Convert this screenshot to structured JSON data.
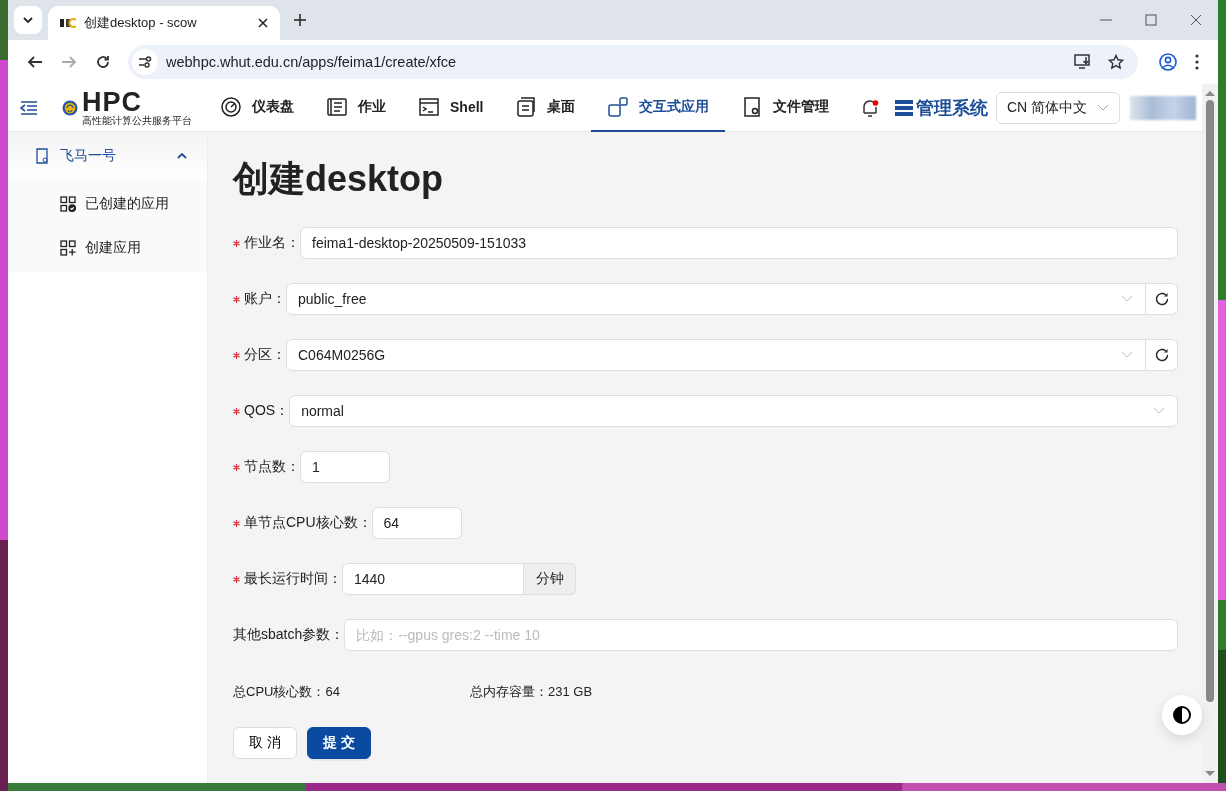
{
  "browser": {
    "tab_title": "创建desktop - scow",
    "url": "webhpc.whut.edu.cn/apps/feima1/create/xfce"
  },
  "header": {
    "logo_text": "HPC",
    "logo_subtitle": "高性能计算公共服务平台",
    "nav": [
      {
        "label": "仪表盘",
        "selected": false
      },
      {
        "label": "作业",
        "selected": false
      },
      {
        "label": "Shell",
        "selected": false
      },
      {
        "label": "桌面",
        "selected": false
      },
      {
        "label": "交互式应用",
        "selected": true
      },
      {
        "label": "文件管理",
        "selected": false
      }
    ],
    "admin_link": "管理系统",
    "language": "CN 简体中文"
  },
  "sidebar": {
    "group": "飞马一号",
    "expanded": true,
    "items": [
      {
        "label": "已创建的应用",
        "selected": false
      },
      {
        "label": "创建应用",
        "selected": false
      }
    ]
  },
  "title": "创建desktop",
  "fields": [
    {
      "label": "作业名：",
      "required": true,
      "kind": "input",
      "value": "feima1-desktop-20250509-151033"
    },
    {
      "label": "账户：",
      "required": true,
      "kind": "select",
      "value": "public_free",
      "refresh": true
    },
    {
      "label": "分区：",
      "required": true,
      "kind": "select",
      "value": "C064M0256G",
      "refresh": true
    },
    {
      "label": "QOS：",
      "required": true,
      "kind": "select",
      "value": "normal",
      "refresh": false
    },
    {
      "label": "节点数：",
      "required": true,
      "kind": "short",
      "value": "1"
    },
    {
      "label": "单节点CPU核心数：",
      "required": true,
      "kind": "short",
      "value": "64"
    },
    {
      "label": "最长运行时间：",
      "required": true,
      "kind": "addon",
      "value": "1440",
      "suffix": "分钟"
    },
    {
      "label": "其他sbatch参数：",
      "required": false,
      "kind": "input",
      "placeholder": "比如：--gpus gres:2 --time 10"
    }
  ],
  "summary": [
    "总CPU核心数：64",
    "总内存容量：231 GB"
  ],
  "buttons": [
    {
      "label": "取 消",
      "kind": "default"
    },
    {
      "label": "提 交",
      "kind": "primary"
    }
  ]
}
